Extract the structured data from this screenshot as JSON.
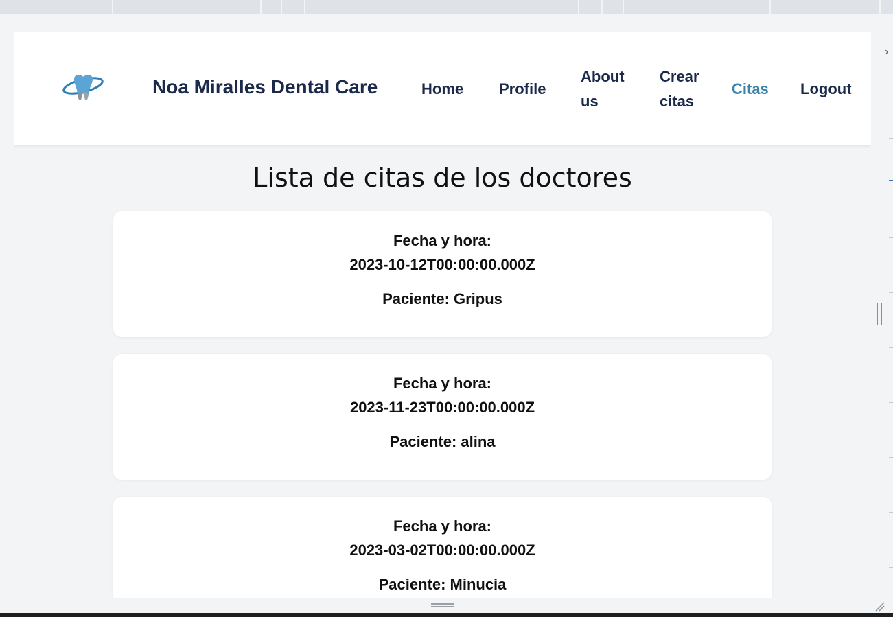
{
  "brand": {
    "name": "Noa Miralles Dental Care",
    "logo_icon": "tooth-logo-icon"
  },
  "nav": {
    "items": [
      {
        "label": "Home",
        "active": false
      },
      {
        "label": "Profile",
        "active": false
      },
      {
        "label": "About us",
        "active": false
      },
      {
        "label": "Crear citas",
        "active": false
      },
      {
        "label": "Citas",
        "active": true
      },
      {
        "label": "Logout",
        "active": false
      }
    ]
  },
  "page": {
    "title": "Lista de citas de los doctores"
  },
  "appointments": [
    {
      "label": "Fecha y hora:",
      "datetime": "2023-10-12T00:00:00.000Z",
      "patient": "Paciente: Gripus"
    },
    {
      "label": "Fecha y hora:",
      "datetime": "2023-11-23T00:00:00.000Z",
      "patient": "Paciente: alina"
    },
    {
      "label": "Fecha y hora:",
      "datetime": "2023-03-02T00:00:00.000Z",
      "patient": "Paciente: Minucia"
    }
  ],
  "colors": {
    "nav_text": "#1b2a4a",
    "nav_active": "#3b82a8",
    "page_bg": "#f3f4f6",
    "card_bg": "#ffffff"
  }
}
